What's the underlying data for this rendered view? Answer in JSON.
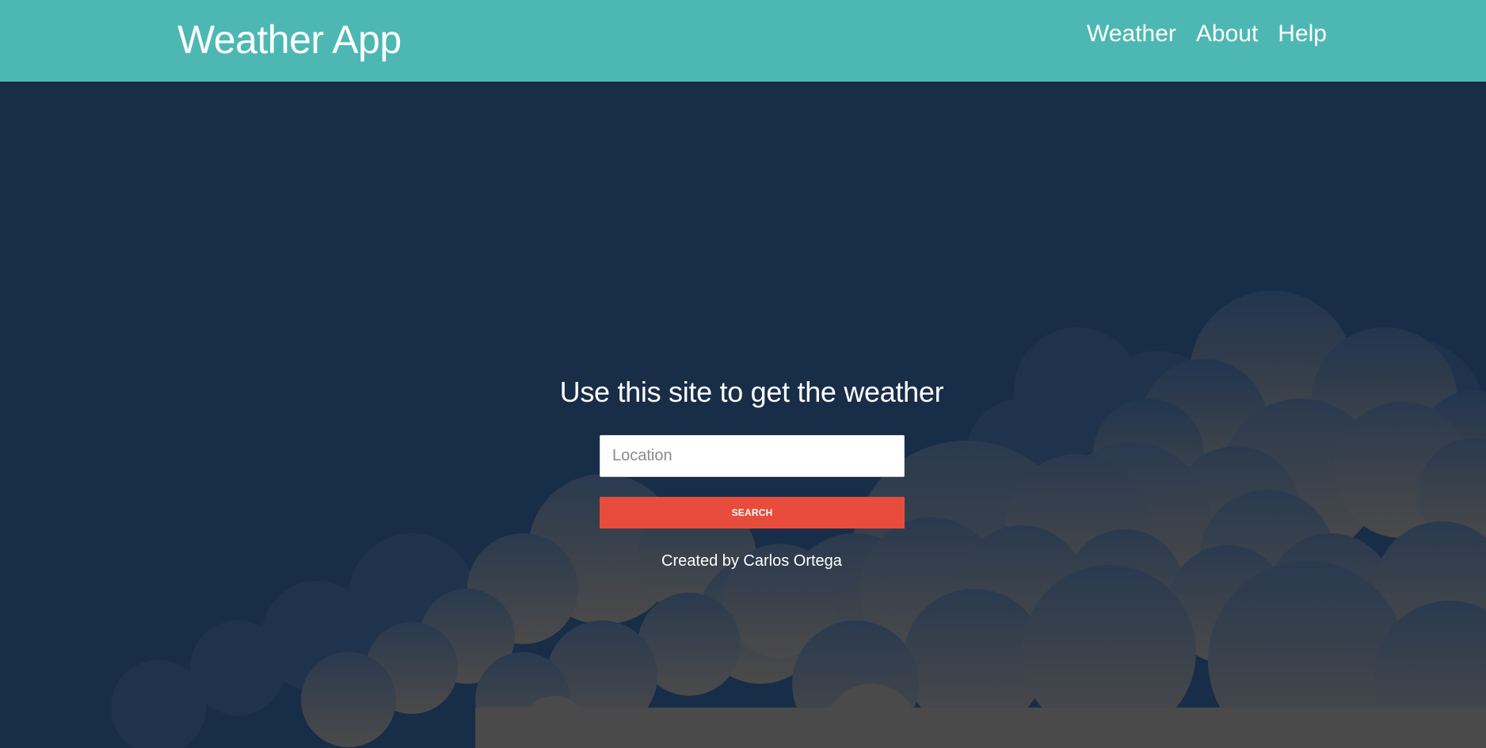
{
  "header": {
    "brand": "Weather App",
    "nav": [
      {
        "label": "Weather"
      },
      {
        "label": "About"
      },
      {
        "label": "Help"
      }
    ]
  },
  "main": {
    "headline": "Use this site to get the weather",
    "location_input": {
      "placeholder": "Location",
      "value": ""
    },
    "search_button": "SEARCH",
    "credit": "Created by Carlos Ortega"
  },
  "colors": {
    "header_bg": "#4db8b3",
    "page_bg": "#182d47",
    "button_bg": "#e74c3c",
    "cloud": "#4a4a4a"
  }
}
